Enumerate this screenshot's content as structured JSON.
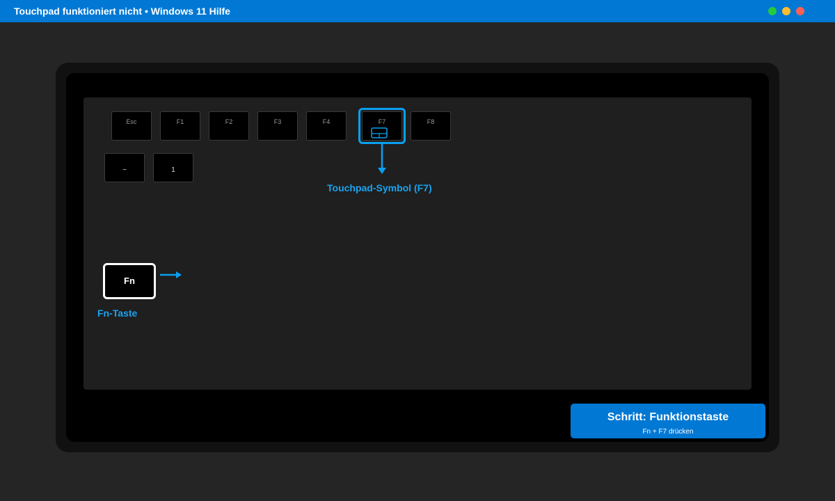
{
  "window": {
    "title": "Touchpad funktioniert nicht • Windows 11 Hilfe",
    "controls": [
      {
        "name": "maximize",
        "color": "#27c93f"
      },
      {
        "name": "minimize",
        "color": "#ffbd2e"
      },
      {
        "name": "close",
        "color": "#ff5f56"
      }
    ]
  },
  "keyboard": {
    "function_row": [
      "Esc",
      "F1",
      "F2",
      "F3",
      "F4",
      "F7",
      "F8"
    ],
    "number_row": [
      "~",
      "1"
    ],
    "highlighted_key": {
      "label": "F7",
      "icon": "touchpad-icon",
      "callout": "Touchpad-Symbol (F7)"
    },
    "fn_key": {
      "label": "Fn",
      "callout": "Fn-Taste"
    }
  },
  "step": {
    "title": "Schritt: Funktionstaste",
    "subtitle": "Fn + F7 drücken"
  },
  "colors": {
    "accent": "#0078d4",
    "highlight": "#0aa0f0",
    "callout_text": "#1aa3f0"
  }
}
